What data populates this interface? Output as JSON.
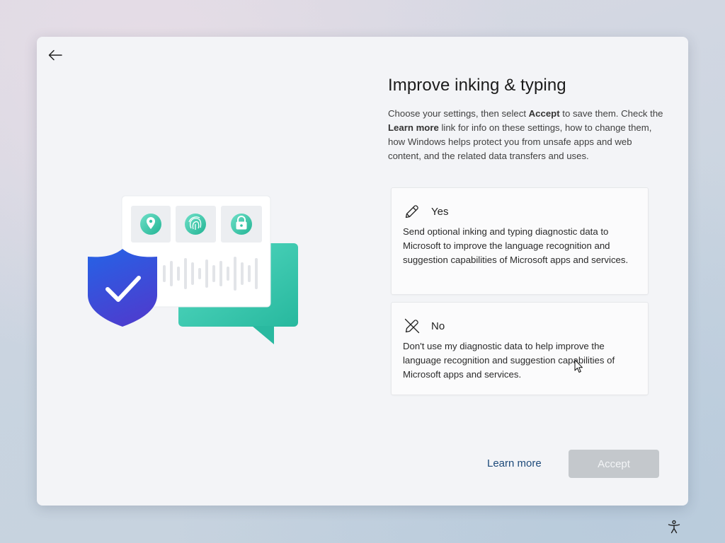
{
  "header": {
    "back_icon": "arrow-left-icon",
    "title": "Improve inking & typing"
  },
  "description": {
    "part1": "Choose your settings, then select ",
    "accept_bold": "Accept",
    "part2": " to save them. Check the ",
    "learn_more_bold": "Learn more",
    "part3": " link for info on these settings, how to change them, how Windows helps protect you from unsafe apps and web content, and the related data transfers and uses."
  },
  "options": {
    "yes": {
      "icon": "pen-icon",
      "title": "Yes",
      "description": "Send optional inking and typing diagnostic data to Microsoft to improve the language recognition and suggestion capabilities of Microsoft apps and services."
    },
    "no": {
      "icon": "pen-off-icon",
      "title": "No",
      "description": "Don't use my diagnostic data to help improve the language recognition and suggestion capabilities of Microsoft apps and services."
    }
  },
  "footer": {
    "learn_more_label": "Learn more",
    "accept_label": "Accept",
    "accept_enabled": false
  },
  "illustration": {
    "icons": [
      "location-pin-icon",
      "fingerprint-icon",
      "lock-icon",
      "shield-check-icon",
      "chat-bubble-icon",
      "audio-wave-icon"
    ]
  },
  "taskbar": {
    "accessibility_icon": "accessibility-icon"
  },
  "colors": {
    "accent_teal": "#3cc8b0",
    "shield_blue": "#2f5ee0",
    "accept_disabled_bg": "#c4c8cc",
    "link": "#1d4a7a"
  }
}
